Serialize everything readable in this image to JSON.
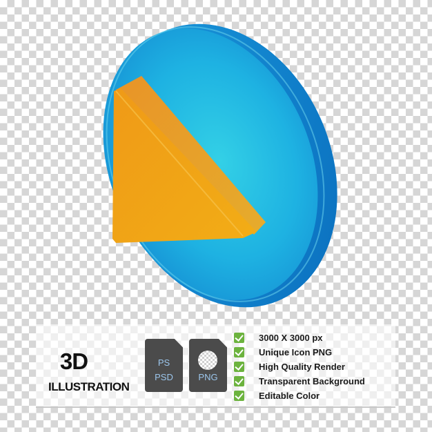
{
  "illustration": {
    "subject": "3D play button icon",
    "icon_name": "play-button-icon",
    "colors": {
      "disc": "#1aa7e0",
      "disc_light": "#33cde8",
      "disc_dark": "#0a74c2",
      "triangle": "#f0a21a",
      "triangle_dark": "#e98a12",
      "triangle_light": "#f5b82a"
    }
  },
  "banner": {
    "title": "3D",
    "subtitle": "ILLUSTRATION",
    "files": [
      {
        "type": "psd",
        "line1": "PS",
        "line2": "PSD"
      },
      {
        "type": "png",
        "line1": "",
        "line2": "PNG"
      }
    ],
    "features": [
      "3000 X 3000 px",
      "Unique Icon PNG",
      "High Quality Render",
      "Transparent Background",
      "Editable Color"
    ],
    "colors": {
      "check": "#6cb33e",
      "file_bg": "#4b4b4b",
      "file_text": "#9cc6ec"
    }
  }
}
